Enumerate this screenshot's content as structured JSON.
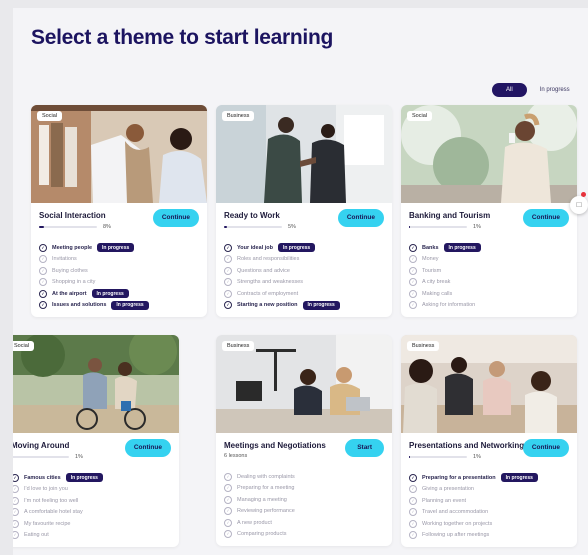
{
  "header": {
    "title": "Select a theme to start learning"
  },
  "filter": {
    "all": "All",
    "in_progress": "In progress"
  },
  "in_progress_badge": "In progress",
  "cards": [
    {
      "tag": "Social",
      "title": "Social Interaction",
      "progress": 8,
      "progress_label": "8%",
      "button": "Continue",
      "lessons": [
        {
          "label": "Meeting people",
          "active": true,
          "badge": true
        },
        {
          "label": "Invitations"
        },
        {
          "label": "Buying clothes"
        },
        {
          "label": "Shopping in a city"
        },
        {
          "label": "At the airport",
          "active": true,
          "badge": true
        },
        {
          "label": "Issues and solutions",
          "active": true,
          "badge": true
        }
      ]
    },
    {
      "tag": "Business",
      "title": "Ready to Work",
      "progress": 5,
      "progress_label": "5%",
      "button": "Continue",
      "lessons": [
        {
          "label": "Your ideal job",
          "active": true,
          "badge": true
        },
        {
          "label": "Roles and responsibilities"
        },
        {
          "label": "Questions and advice"
        },
        {
          "label": "Strengths and weaknesses"
        },
        {
          "label": "Contracts of employment"
        },
        {
          "label": "Starting a new position",
          "active": true,
          "badge": true
        }
      ]
    },
    {
      "tag": "Social",
      "title": "Banking and Tourism",
      "progress": 1,
      "progress_label": "1%",
      "button": "Continue",
      "lessons": [
        {
          "label": "Banks",
          "active": true,
          "badge": true
        },
        {
          "label": "Money"
        },
        {
          "label": "Tourism"
        },
        {
          "label": "A city break"
        },
        {
          "label": "Making calls"
        },
        {
          "label": "Asking for information"
        }
      ]
    },
    {
      "tag": "Social",
      "title": "Moving Around",
      "progress": 1,
      "progress_label": "1%",
      "button": "Continue",
      "lessons": [
        {
          "label": "Famous cities",
          "active": true,
          "badge": true
        },
        {
          "label": "I'd love to join you"
        },
        {
          "label": "I'm not feeling too well"
        },
        {
          "label": "A comfortable hotel stay"
        },
        {
          "label": "My favourite recipe"
        },
        {
          "label": "Eating out"
        }
      ]
    },
    {
      "tag": "Business",
      "title": "Meetings and Negotiations",
      "lessons_count": "6 lessons",
      "button": "Start",
      "lessons": [
        {
          "label": "Dealing with complaints"
        },
        {
          "label": "Preparing for a meeting"
        },
        {
          "label": "Managing a meeting"
        },
        {
          "label": "Reviewing performance"
        },
        {
          "label": "A new product"
        },
        {
          "label": "Comparing products"
        }
      ]
    },
    {
      "tag": "Business",
      "title": "Presentations and Networking",
      "progress": 1,
      "progress_label": "1%",
      "button": "Continue",
      "lessons": [
        {
          "label": "Preparing for a presentation",
          "active": true,
          "badge": true
        },
        {
          "label": "Giving a presentation"
        },
        {
          "label": "Planning an event"
        },
        {
          "label": "Travel and accommodation"
        },
        {
          "label": "Working together on projects"
        },
        {
          "label": "Following up after meetings"
        }
      ]
    }
  ],
  "colors": {
    "accent": "#35d2f0",
    "primary": "#231760",
    "background": "#f4f4f7"
  }
}
